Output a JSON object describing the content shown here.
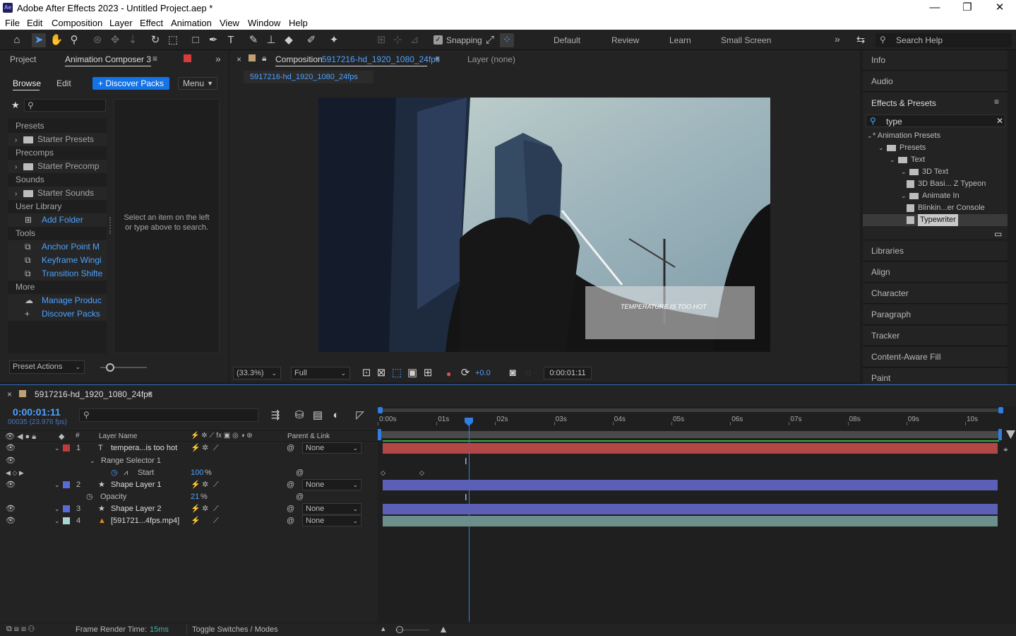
{
  "app": {
    "title": "Adobe After Effects 2023 - Untitled Project.aep *",
    "icon_text": "Ae",
    "window_controls": {
      "minimize": "—",
      "maximize": "❐",
      "close": "✕"
    }
  },
  "menu": [
    "File",
    "Edit",
    "Composition",
    "Layer",
    "Effect",
    "Animation",
    "View",
    "Window",
    "Help"
  ],
  "toolbar": {
    "snapping_label": "Snapping",
    "workspaces": [
      "Default",
      "Review",
      "Learn",
      "Small Screen"
    ],
    "overflow": "»",
    "search_placeholder": "Search Help"
  },
  "left_panel": {
    "tabs": {
      "project": "Project",
      "composer": "Animation Composer 3"
    },
    "subtabs": {
      "browse": "Browse",
      "edit": "Edit"
    },
    "discover_button": "+ Discover Packs",
    "menu_button": "Menu",
    "sections": [
      {
        "header": "Presets",
        "items": [
          {
            "label": "Starter Presets",
            "type": "folder"
          }
        ]
      },
      {
        "header": "Precomps",
        "items": [
          {
            "label": "Starter Precomp",
            "type": "folder"
          }
        ]
      },
      {
        "header": "Sounds",
        "items": [
          {
            "label": "Starter Sounds",
            "type": "folder"
          }
        ]
      },
      {
        "header": "User Library",
        "items": [
          {
            "label": "Add Folder",
            "type": "add"
          }
        ]
      },
      {
        "header": "Tools",
        "items": [
          {
            "label": "Anchor Point M",
            "type": "tool"
          },
          {
            "label": "Keyframe Wingi",
            "type": "tool"
          },
          {
            "label": "Transition Shifte",
            "type": "tool"
          }
        ]
      },
      {
        "header": "More",
        "items": [
          {
            "label": "Manage Produc",
            "type": "cloud"
          },
          {
            "label": "Discover Packs",
            "type": "plus"
          }
        ]
      }
    ],
    "empty_message": "Select an item on the left or type above to search.",
    "preset_actions": "Preset Actions"
  },
  "composition": {
    "tab_prefix": "Composition",
    "tab_name": "5917216-hd_1920_1080_24fps",
    "layer_tab": "Layer (none)",
    "crumb": "5917216-hd_1920_1080_24fps",
    "overlay_text": "TEMPERATURE IS TOO HOT",
    "zoom": "(33.3%)",
    "resolution": "Full",
    "exposure": "+0.0",
    "timecode": "0:00:01:11"
  },
  "right_panel": {
    "top_items": [
      "Info",
      "Audio"
    ],
    "effects_title": "Effects & Presets",
    "search_value": "type",
    "tree": [
      {
        "label": "* Animation Presets",
        "depth": 0,
        "kind": "root"
      },
      {
        "label": "Presets",
        "depth": 1,
        "kind": "folder"
      },
      {
        "label": "Text",
        "depth": 2,
        "kind": "folder"
      },
      {
        "label": "3D Text",
        "depth": 3,
        "kind": "folder"
      },
      {
        "label": "3D Basi... Z Typeon",
        "depth": 4,
        "kind": "preset"
      },
      {
        "label": "Animate In",
        "depth": 3,
        "kind": "folder"
      },
      {
        "label": "Blinkin...er Console",
        "depth": 4,
        "kind": "preset"
      },
      {
        "label": "Typewriter",
        "depth": 4,
        "kind": "preset",
        "selected": true
      }
    ],
    "bottom_items": [
      "Libraries",
      "Align",
      "Character",
      "Paragraph",
      "Tracker",
      "Content-Aware Fill",
      "Paint"
    ]
  },
  "timeline": {
    "comp_name": "5917216-hd_1920_1080_24fps",
    "timecode": "0:00:01:11",
    "frame_info": "00035 (23.976 fps)",
    "col_layer_name": "Layer Name",
    "col_parent": "Parent & Link",
    "ruler_labels": [
      "0:00s",
      "01s",
      "02s",
      "03s",
      "04s",
      "05s",
      "06s",
      "07s",
      "08s",
      "09s",
      "10s"
    ],
    "rows": [
      {
        "num": "1",
        "name": "tempera...is too hot",
        "kind": "text",
        "color": "#c23a3a",
        "parent": "None",
        "bar": "#b34646"
      },
      {
        "name": "Range Selector 1",
        "kind": "group"
      },
      {
        "name": "Start",
        "kind": "prop",
        "value": "100",
        "unit": "%"
      },
      {
        "num": "2",
        "name": "Shape Layer 1",
        "kind": "shape",
        "color": "#5c6ad6",
        "parent": "None",
        "bar": "#5b5fb5"
      },
      {
        "name": "Opacity",
        "kind": "prop",
        "value": "21",
        "unit": "%"
      },
      {
        "num": "3",
        "name": "Shape Layer 2",
        "kind": "shape",
        "color": "#5c6ad6",
        "parent": "None",
        "bar": "#5b5fb5"
      },
      {
        "num": "4",
        "name": "[591721...4fps.mp4]",
        "kind": "footage",
        "color": "#a7d6cf",
        "parent": "None",
        "bar": "#6d8f8b"
      }
    ],
    "frame_render_label": "Frame Render Time:",
    "frame_render_value": "15ms",
    "toggle_label": "Toggle Switches / Modes"
  }
}
